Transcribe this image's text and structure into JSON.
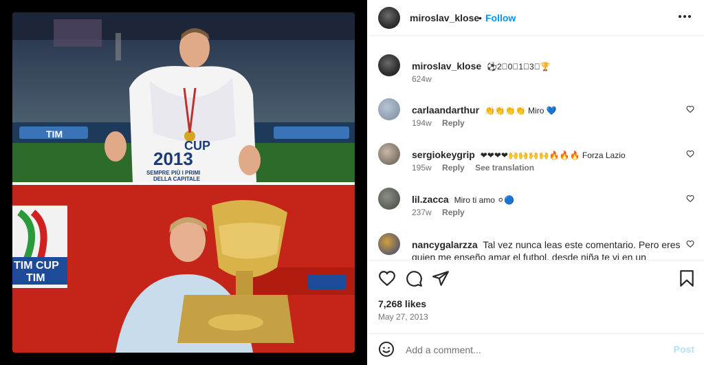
{
  "post": {
    "username": "miroslav_klose",
    "follow_label": "Follow",
    "header_dot": "•",
    "caption_text": "⚽2⃣0⃣1⃣3⃣🏆",
    "caption_time": "624w",
    "likes": "7,268 likes",
    "date": "May 27, 2013"
  },
  "photo": {
    "top_banner": "TIM",
    "shirt_line1": "CUP",
    "shirt_line2": "2013",
    "shirt_line3": "SEMPRE PIÙ I PRIMI",
    "shirt_line4": "DELLA CAPITALE",
    "bottom_banner": "TIM CUP",
    "bottom_brand": "TIM"
  },
  "comments": [
    {
      "user": "carlaandarthur",
      "text": "👏👏👏👏 Miro 💙",
      "time": "194w",
      "reply": "Reply",
      "translate": ""
    },
    {
      "user": "sergiokeygrip",
      "text": "❤❤❤❤🙌🙌🙌🙌🔥🔥🔥 Forza Lazio",
      "time": "195w",
      "reply": "Reply",
      "translate": "See translation"
    },
    {
      "user": "lil.zacca",
      "text": "Miro ti amo ⚪🔵",
      "time": "237w",
      "reply": "Reply",
      "translate": ""
    },
    {
      "user": "nancygalarzza",
      "text": "Tal vez nunca leas este comentario. Pero eres quien me enseño amar el futbol. desde niña te vi en un",
      "time": "",
      "reply": "",
      "translate": ""
    }
  ],
  "composer": {
    "placeholder": "Add a comment...",
    "post_label": "Post"
  },
  "colors": {
    "accent": "#0095f6",
    "post_disabled": "#b2dffc",
    "muted": "#737373"
  },
  "icons": [
    "heart-icon",
    "comment-icon",
    "share-icon",
    "bookmark-icon",
    "smile-icon",
    "more-icon"
  ]
}
